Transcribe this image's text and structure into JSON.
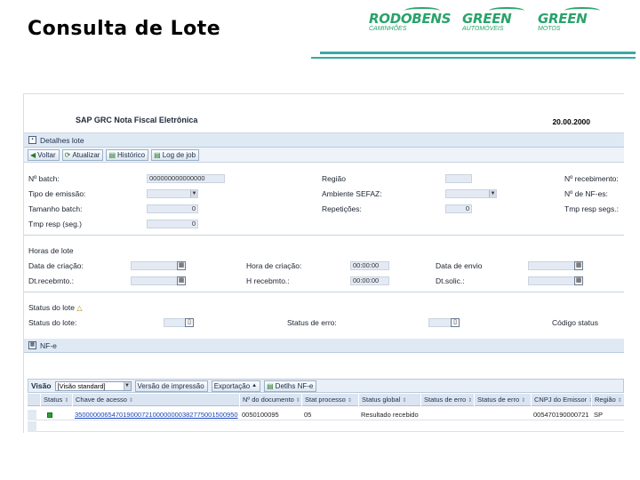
{
  "slide": {
    "title": "Consulta de Lote",
    "logos": [
      {
        "name": "RODOBENS",
        "sub": "CAMINHÕES"
      },
      {
        "name": "GREEN",
        "sub": "AUTOMÓVEIS"
      },
      {
        "name": "GREEN",
        "sub": "MOTOS"
      }
    ],
    "accent_color": "#3aa9a0",
    "logo_color": "#2aa36b"
  },
  "sap": {
    "app_title": "SAP GRC Nota Fiscal Eletrônica",
    "date": "20.00.2000",
    "detail_panel": {
      "title": "Detalhes lote",
      "toolbar": {
        "back": "Voltar",
        "refresh": "Atualizar",
        "history": "Histórico",
        "job_log": "Log de job"
      },
      "fields": {
        "batch_no_label": "Nº batch:",
        "batch_no_value": "000000000000000",
        "emission_type_label": "Tipo de emissão:",
        "batch_size_label": "Tamanho batch:",
        "batch_size_value": "0",
        "tmp_resp_label": "Tmp resp (seg.)",
        "tmp_resp_value": "0",
        "region_label": "Região",
        "sefaz_env_label": "Ambiente SEFAZ:",
        "repetitions_label": "Repetições:",
        "repetitions_value": "0",
        "receipt_no_label": "Nº recebimento:",
        "nfe_no_label": "Nº de NF-es:",
        "tmp_resp_segs_label": "Tmp resp segs.:"
      }
    },
    "hours_section": {
      "title": "Horas de lote",
      "creation_date_label": "Data de criação:",
      "creation_time_label": "Hora de criação:",
      "creation_time_value": "00:00:00",
      "send_date_label": "Data de envio",
      "receipt_date_label": "Dt.recebmto.:",
      "receipt_time_label": "H recebmto.:",
      "receipt_time_value": "00:00:00",
      "request_date_label": "Dt.solic.:"
    },
    "status_section": {
      "title": "Status do lote",
      "batch_status_label": "Status do lote:",
      "error_status_label": "Status de erro:",
      "status_code_label": "Código status"
    },
    "nfe_panel": {
      "title": "NF-e",
      "view_label": "Visão",
      "view_value": "[Visão standard]",
      "print_version": "Versão de impressão",
      "export": "Exportação",
      "details": "Detlhs NF-e",
      "columns": [
        "Status",
        "Chave de acesso",
        "Nº do documento",
        "Stat processo",
        "Status global",
        "Status de erro",
        "Status de erro",
        "CNPJ do Emissor",
        "Região"
      ],
      "rows": [
        [
          "",
          "35000000654701900072100000000382775001500950",
          "0050100095",
          "05",
          "Resultado recebido",
          "",
          "",
          "005470190000721",
          "SP"
        ]
      ]
    }
  }
}
